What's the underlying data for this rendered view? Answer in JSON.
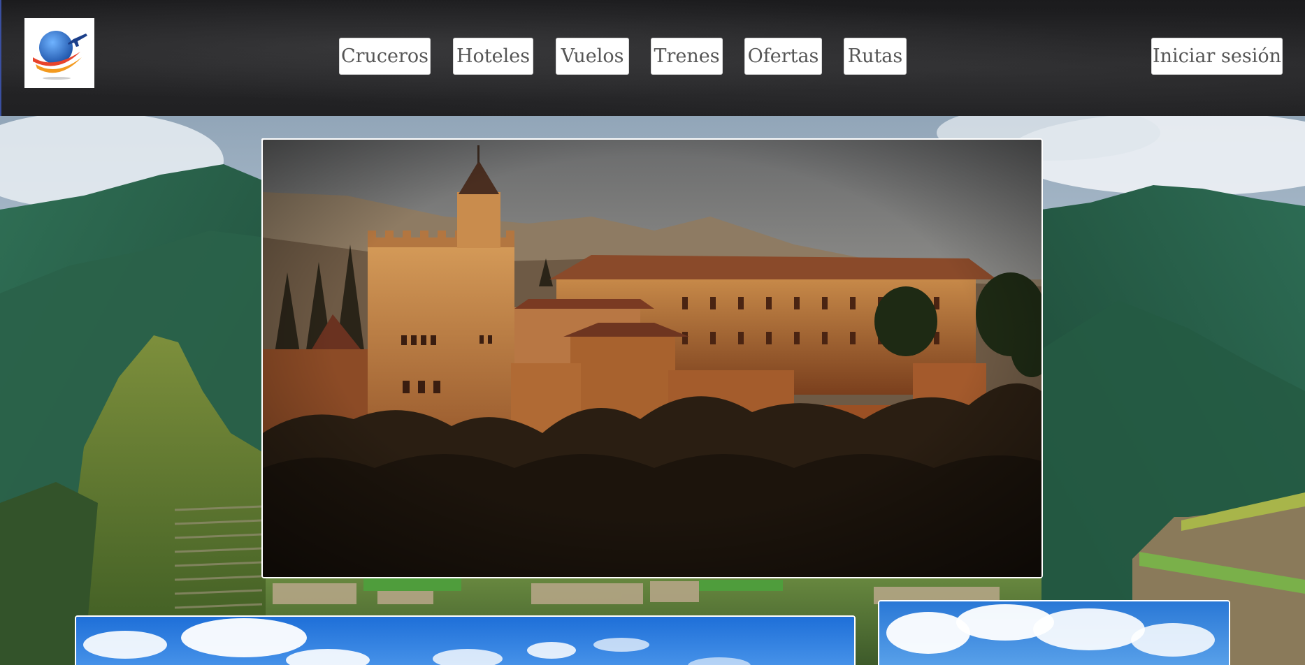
{
  "header": {
    "logo_icon": "globe-airplane-logo-icon",
    "nav": [
      {
        "label": "Cruceros"
      },
      {
        "label": "Hoteles"
      },
      {
        "label": "Vuelos"
      },
      {
        "label": "Trenes"
      },
      {
        "label": "Ofertas"
      },
      {
        "label": "Rutas"
      }
    ],
    "login_label": "Iniciar sesión"
  },
  "images": {
    "background": "mountain-ruins-landscape",
    "featured": "fortress-palace-at-sunset",
    "card_left": "sky-with-clouds",
    "card_right": "sky-with-clouds"
  },
  "colors": {
    "header_bg": "#222224",
    "button_bg": "#ffffff",
    "button_text": "#555555"
  }
}
